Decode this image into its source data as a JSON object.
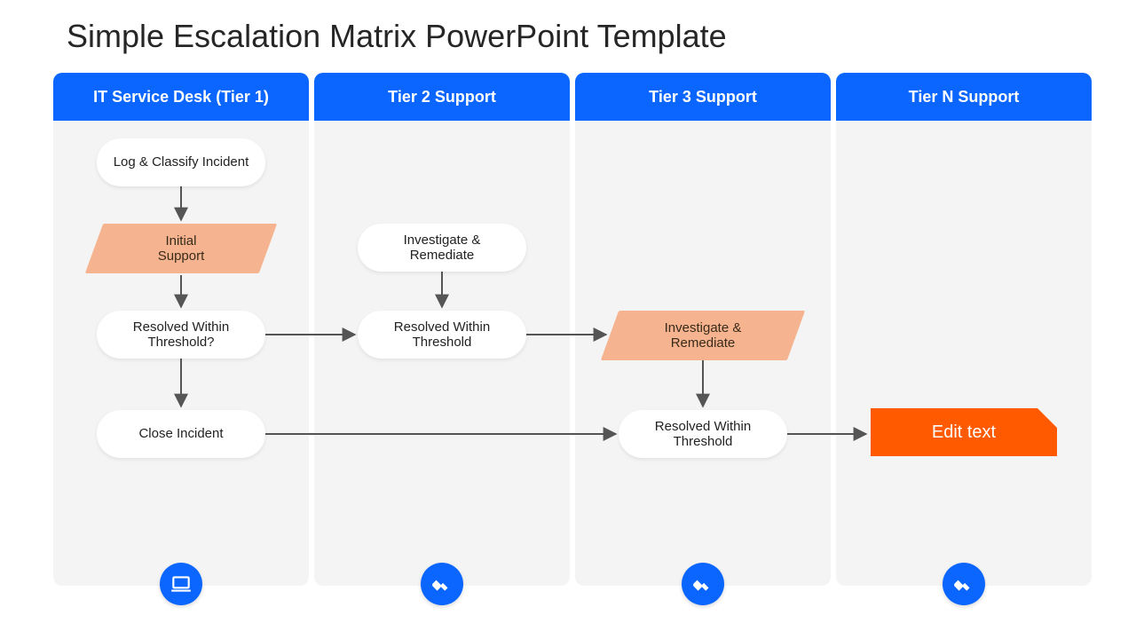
{
  "title": "Simple Escalation Matrix PowerPoint Template",
  "columns": [
    {
      "header": "IT Service Desk (Tier 1)"
    },
    {
      "header": "Tier 2 Support"
    },
    {
      "header": "Tier 3 Support"
    },
    {
      "header": "Tier N Support"
    }
  ],
  "nodes": {
    "c1_log": "Log & Classify Incident",
    "c1_initial": "Initial Support",
    "c1_resolved": "Resolved Within Threshold?",
    "c1_close": "Close Incident",
    "c2_invest": "Investigate & Remediate",
    "c2_resolved": "Resolved Within Threshold",
    "c3_invest": "Investigate & Remediate",
    "c3_resolved": "Resolved Within Threshold",
    "c4_edit": "Edit text"
  }
}
